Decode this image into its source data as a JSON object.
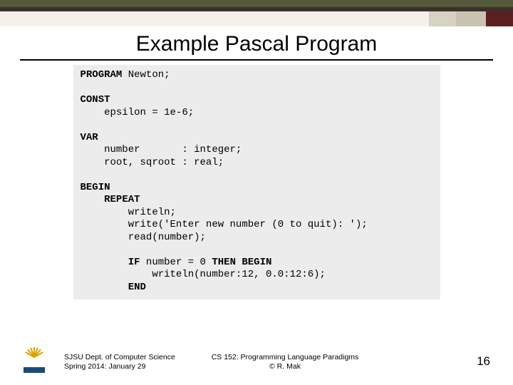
{
  "title": "Example Pascal Program",
  "code": {
    "l1_kw": "PROGRAM",
    "l1_rest": " Newton;",
    "l3_kw": "CONST",
    "l4": "    epsilon = 1e-6;",
    "l6_kw": "VAR",
    "l7": "    number       : integer;",
    "l8": "    root, sqroot : real;",
    "l10_kw": "BEGIN",
    "l11_ind": "    ",
    "l11_kw": "REPEAT",
    "l12": "        writeln;",
    "l13": "        write('Enter new number (0 to quit): ');",
    "l14": "        read(number);",
    "l16_ind": "        ",
    "l16_kw1": "IF",
    "l16_mid": " number = 0 ",
    "l16_kw2": "THEN BEGIN",
    "l17": "            writeln(number:12, 0.0:12:6);",
    "l18_ind": "        ",
    "l18_kw": "END"
  },
  "footer": {
    "left1": "SJSU Dept. of Computer Science",
    "left2": "Spring 2014: January 29",
    "center1": "CS 152: Programming Language Paradigms",
    "center2": "© R. Mak",
    "page": "16"
  }
}
